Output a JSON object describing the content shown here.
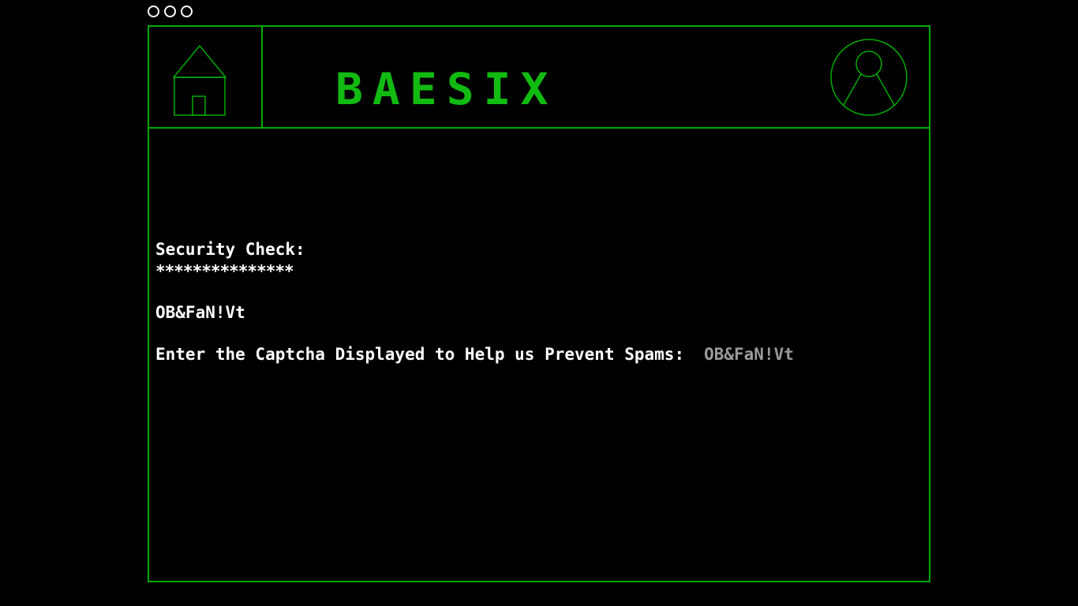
{
  "app": {
    "brand": "BAESIX"
  },
  "colors": {
    "accent": "#00aa00",
    "brand": "#11bb11",
    "text": "#ffffff",
    "placeholder": "#9a9a9a",
    "background": "#000000"
  },
  "window_controls": [
    "circle-icon",
    "circle-icon",
    "circle-icon"
  ],
  "header": {
    "home_icon": "house-icon",
    "profile_icon": "user-avatar-icon"
  },
  "security": {
    "title": "Security Check:",
    "divider": "***************",
    "captcha_code": "OB&FaN!Vt",
    "prompt": "Enter the Captcha Displayed to Help us Prevent Spams:",
    "input_placeholder": "OB&FaN!Vt",
    "input_value": ""
  }
}
